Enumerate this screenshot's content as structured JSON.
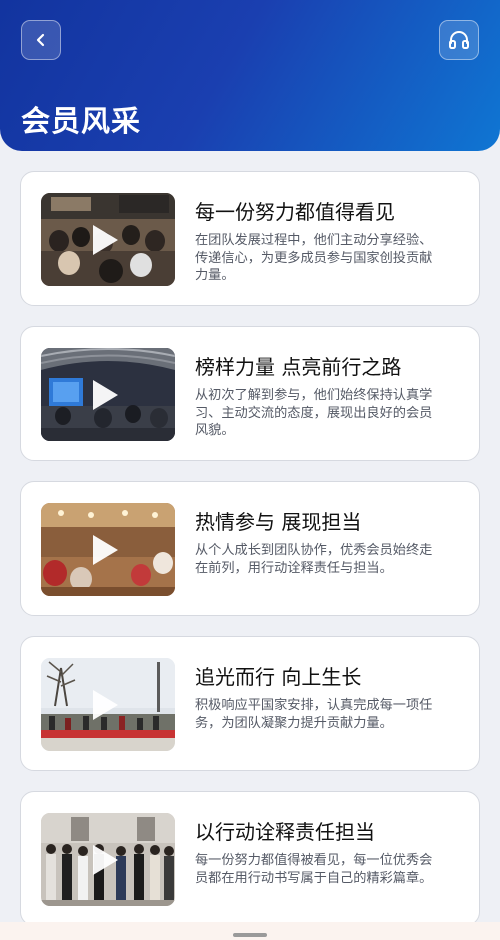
{
  "header": {
    "title": "会员风采",
    "back_icon": "chevron-left-icon",
    "support_icon": "headphones-icon",
    "gradient": [
      "#12349f",
      "#0f76d3"
    ]
  },
  "cards": [
    {
      "title": "每一份努力都值得看见",
      "description": "在团队发展过程中，他们主动分享经验、传递信心，为更多成员参与国家创投贡献力量。",
      "thumbnail": "conference-audience-scene"
    },
    {
      "title": "榜样力量 点亮前行之路",
      "description": "从初次了解到参与，他们始终保持认真学习、主动交流的态度，展现出良好的会员风貌。",
      "thumbnail": "stage-event-scene"
    },
    {
      "title": "热情参与 展现担当",
      "description": "从个人成长到团队协作，优秀会员始终走在前列，用行动诠释责任与担当。",
      "thumbnail": "banquet-hall-scene"
    },
    {
      "title": "追光而行 向上生长",
      "description": "积极响应平国家安排，认真完成每一项任务，为团队凝聚力提升贡献力量。",
      "thumbnail": "outdoor-group-scene"
    },
    {
      "title": "以行动诠释责任担当",
      "description": "每一份努力都值得被看见，每一位优秀会员都在用行动书写属于自己的精彩篇章。",
      "thumbnail": "group-photo-scene"
    }
  ]
}
